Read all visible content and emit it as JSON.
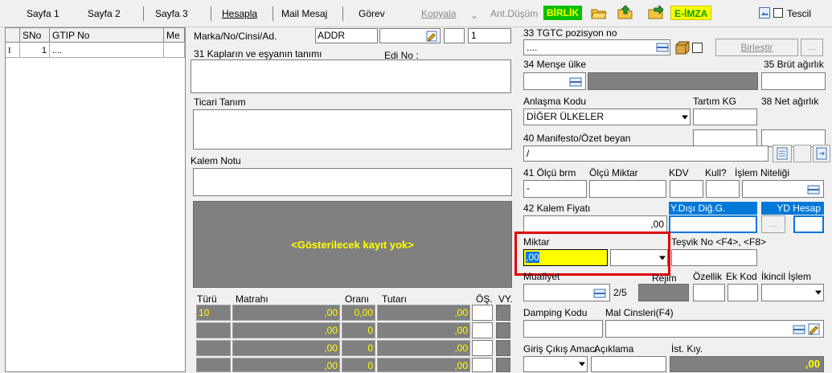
{
  "toolbar": {
    "sayfa1": "Sayfa 1",
    "sayfa2": "Sayfa 2",
    "sayfa3": "Sayfa 3",
    "hesapla": "Hesapla",
    "mail": "Mail Mesaj",
    "gorev": "Görev",
    "kopyala": "Kopyala",
    "antdusum": "Ant.Düşüm",
    "birlik": "BİRLİK",
    "eimza": "E-İMZA",
    "tescil": "Tescil"
  },
  "grid": {
    "headers": [
      "SNo",
      "GTIP No",
      "Me"
    ],
    "row_marker": "I",
    "row": {
      "sno": "1",
      "gtip": "...."
    }
  },
  "form": {
    "marka_label": "Marka/No/Cinsi/Ad.",
    "marka_value": "ADDR",
    "marka_num": "1",
    "kap_label": "31 Kapların ve eşyanın tanımı",
    "edi_label": "Edi No :",
    "ticari_label": "Ticari Tanım",
    "kalem_notu_label": "Kalem Notu",
    "no_record": "<Gösterilecek kayıt yok>",
    "tax_headers": {
      "turu": "Türü",
      "matrahi": "Matrahı",
      "orani": "Oranı",
      "tutari": "Tutarı",
      "os": "ÖŞ.",
      "vy": "VY."
    },
    "tax_rows": [
      {
        "turu": "10",
        "matrahi": ",00",
        "orani": "0,00",
        "tutari": ",00"
      },
      {
        "turu": "",
        "matrahi": ",00",
        "orani": "0",
        "tutari": ",00"
      },
      {
        "turu": "",
        "matrahi": ",00",
        "orani": "0",
        "tutari": ",00"
      },
      {
        "turu": "",
        "matrahi": ",00",
        "orani": "0",
        "tutari": ",00"
      }
    ]
  },
  "right": {
    "tgtc_label": "33 TGTC pozisyon no",
    "tgtc_value": "....",
    "birlestir": "Birleştir",
    "dots": "....",
    "mense_label": "34 Menşe ülke",
    "brut_label": "35 Brüt ağırlık",
    "anlasma_label": "Anlaşma Kodu",
    "anlasma_value": "DİĞER ÜLKELER",
    "tartim_label": "Tartım KG",
    "net_label": "38 Net ağırlık",
    "manifesto_label": "40 Manifesto/Özet beyan",
    "manifesto_value": "/",
    "olcu_brm_label": "41 Ölçü brm",
    "olcu_miktar_label": "Ölçü Miktar",
    "kdv_label": "KDV",
    "kull_label": "Kull?",
    "islem_label": "İşlem Niteliği",
    "olcu_brm_value": "-",
    "kalem_fiyati_label": "42 Kalem Fiyatı",
    "kalem_fiyati_value": ",00",
    "ydisi_label": "Y.Dışı Diğ.G.",
    "yd_hesap_label": "YD Hesap",
    "miktar_label": "Miktar",
    "miktar_value": ",00",
    "tesvik_label": "Teşvik No <F4>, <F8>",
    "muafiyet_label": "Muafiyet",
    "rejim_label": "Rejim",
    "ozellik_label": "Özellik",
    "ek_kod_label": "Ek Kod",
    "ikincil_label": "İkincil İşlem",
    "page_indicator": "2/5",
    "damping_label": "Damping Kodu",
    "mal_cinsleri_label": "Mal Cinsleri(F4)",
    "giris_label": "Giriş Çıkış Amacı",
    "aciklama_label": "Açıklama",
    "ist_label": "İst. Kıy.",
    "ist_value": ",00"
  },
  "colors": {
    "highlight": "#ffff00",
    "selection_border": "#e00000",
    "accent_blue": "#0078d7",
    "green_brand": "#00c000"
  }
}
